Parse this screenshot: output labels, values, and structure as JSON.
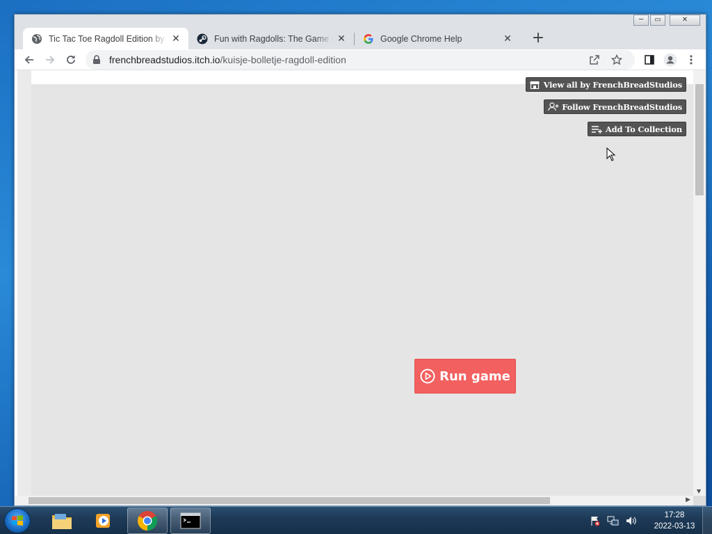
{
  "browser": {
    "tabs": [
      {
        "title": "Tic Tac Toe Ragdoll Edition by FrenchBreadStudios",
        "icon": "globe-icon",
        "active": true
      },
      {
        "title": "Fun with Ragdolls: The Game on Steam",
        "icon": "steam-icon",
        "active": false
      },
      {
        "title": "Google Chrome Help",
        "icon": "google-icon",
        "active": false
      }
    ],
    "new_tab_label": "+",
    "caption": {
      "minimize": "─",
      "maximize": "▭",
      "close": "✕"
    }
  },
  "toolbar": {
    "url_host": "frenchbreadstudios.itch.io",
    "url_path": "/kuisje-bolletje-ragdoll-edition"
  },
  "page": {
    "user_tools": {
      "view_all": "View all by FrenchBreadStudios",
      "follow": "Follow FrenchBreadStudios",
      "add_collection": "Add To Collection"
    },
    "run_game": "Run game",
    "accent_color": "#f26060"
  },
  "taskbar": {
    "apps": [
      "windows-explorer",
      "media-player",
      "google-chrome",
      "command-prompt"
    ],
    "clock_time": "17:28",
    "clock_date": "2022-03-13"
  }
}
